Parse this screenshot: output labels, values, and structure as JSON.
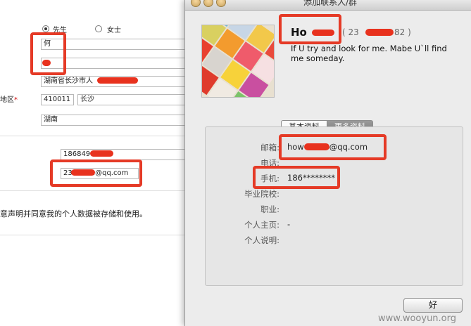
{
  "form": {
    "gender_male": "先生",
    "gender_female": "女士",
    "surname_value": "何",
    "name_value": "",
    "address_value": "湖南省长沙市人",
    "region_label": "地区",
    "region_required": "*",
    "postcode_value": "410011",
    "city_value": "长沙",
    "province_value": "湖南",
    "phone_value": "186849",
    "email_value_start": "23",
    "email_value_end": "2@qq.com",
    "consent_text": "意声明并同意我的个人数据被存储和使用。"
  },
  "dialog": {
    "title": "添加联系人/群",
    "name": "Ho",
    "qq_prefix": "( 23",
    "qq_suffix": "82 )",
    "signature": "If U try and look for me.    Mabe U`ll find me someday.",
    "tabs": [
      {
        "label": "基本资料",
        "active": true
      },
      {
        "label": "更多资料",
        "active": false
      }
    ],
    "fields": [
      {
        "label": "邮箱:",
        "value": "how"
      },
      {
        "label": "电话:",
        "value": ""
      },
      {
        "label": "手机:",
        "value": "186********"
      },
      {
        "label": "毕业院校:",
        "value": ""
      },
      {
        "label": "职业:",
        "value": ""
      },
      {
        "label": "个人主页:",
        "value": "-"
      },
      {
        "label": "个人说明:",
        "value": ""
      }
    ],
    "email_suffix": "@qq.com",
    "ok_button": "好"
  },
  "watermark": "www.wooyun.org",
  "colors": {
    "highlight": "#e53a26",
    "redaction": "#e8321e"
  }
}
